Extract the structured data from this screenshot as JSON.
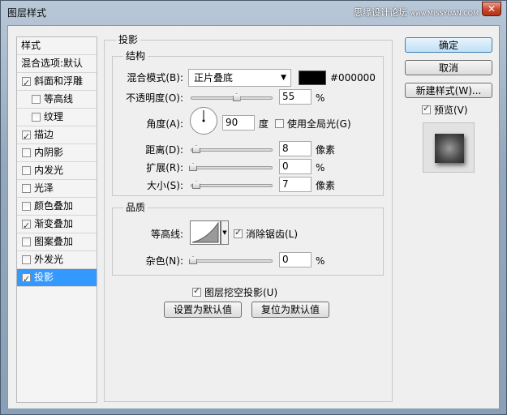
{
  "window": {
    "title": "图层样式",
    "watermark": "思缘设计论坛",
    "watermark_url": "www.MISSYUAN.COM",
    "close_glyph": "✕"
  },
  "left_list": {
    "header": "样式",
    "blend_options": "混合选项:默认",
    "items": [
      {
        "label": "斜面和浮雕",
        "checked": true
      },
      {
        "label": "等高线",
        "checked": false
      },
      {
        "label": "纹理",
        "checked": false
      },
      {
        "label": "描边",
        "checked": true
      },
      {
        "label": "内阴影",
        "checked": false
      },
      {
        "label": "内发光",
        "checked": false
      },
      {
        "label": "光泽",
        "checked": false
      },
      {
        "label": "颜色叠加",
        "checked": false
      },
      {
        "label": "渐变叠加",
        "checked": true
      },
      {
        "label": "图案叠加",
        "checked": false
      },
      {
        "label": "外发光",
        "checked": false
      },
      {
        "label": "投影",
        "checked": true,
        "selected": true
      }
    ]
  },
  "drop_shadow": {
    "title": "投影",
    "structure": {
      "title": "结构",
      "blend_mode_label": "混合模式(B):",
      "blend_mode_value": "正片叠底",
      "color_hex": "#000000",
      "color": "#000000",
      "opacity_label": "不透明度(O):",
      "opacity_value": "55",
      "opacity_unit": "%",
      "opacity_fraction": 0.55,
      "angle_label": "角度(A):",
      "angle_value": "90",
      "angle_unit": "度",
      "global_light_label": "使用全局光(G)",
      "global_light_checked": false,
      "distance_label": "距离(D):",
      "distance_value": "8",
      "distance_unit": "像素",
      "spread_label": "扩展(R):",
      "spread_value": "0",
      "spread_unit": "%",
      "size_label": "大小(S):",
      "size_value": "7",
      "size_unit": "像素"
    },
    "quality": {
      "title": "品质",
      "contour_label": "等高线:",
      "anti_alias_label": "消除锯齿(L)",
      "anti_alias_checked": true,
      "noise_label": "杂色(N):",
      "noise_value": "0",
      "noise_unit": "%"
    },
    "knockout_label": "图层挖空投影(U)",
    "knockout_checked": true,
    "set_default_button": "设置为默认值",
    "reset_default_button": "复位为默认值"
  },
  "buttons": {
    "ok": "确定",
    "cancel": "取消",
    "new_style": "新建样式(W)...",
    "preview_label": "预览(V)",
    "preview_checked": true
  }
}
